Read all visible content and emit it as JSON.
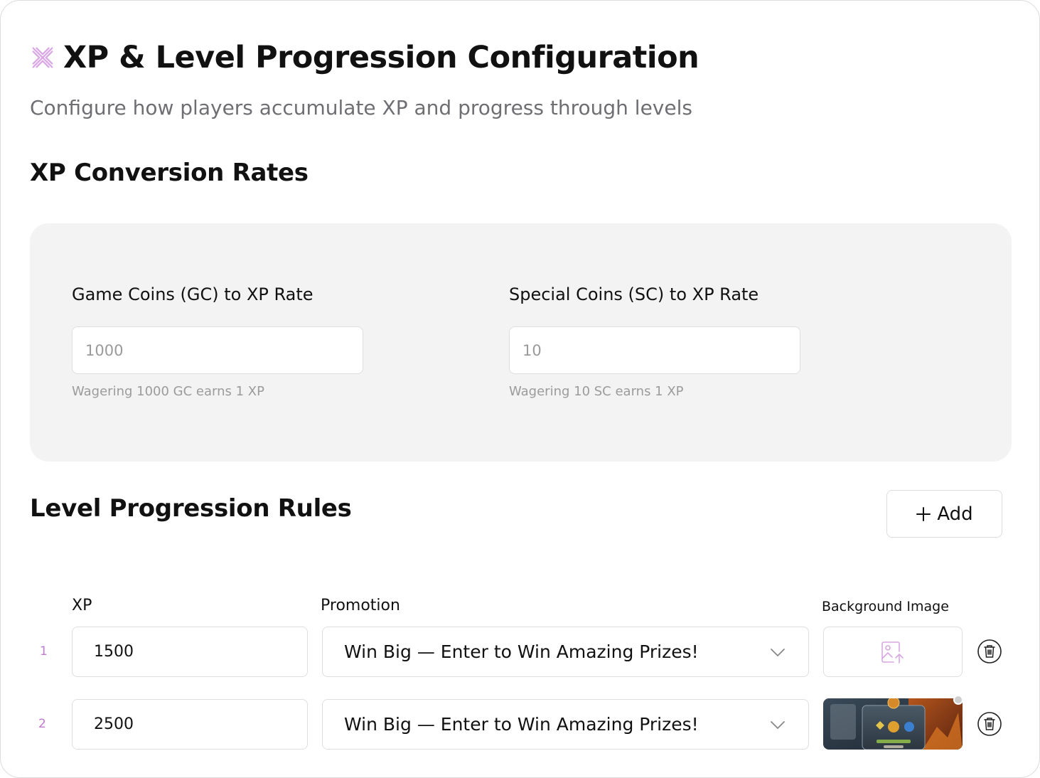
{
  "header": {
    "title": "XP & Level Progression Configuration",
    "subtitle": "Configure how players accumulate XP and progress through levels",
    "logo_icon": "sparkle-cross-icon"
  },
  "conversion": {
    "heading": "XP Conversion Rates",
    "gc": {
      "label": "Game Coins (GC) to XP Rate",
      "placeholder": "1000",
      "hint": "Wagering 1000 GC earns 1 XP"
    },
    "sc": {
      "label": "Special Coins (SC) to XP Rate",
      "placeholder": "10",
      "hint": "Wagering 10 SC earns 1 XP"
    }
  },
  "levels": {
    "heading": "Level Progression Rules",
    "add_label": "Add",
    "columns": {
      "xp": "XP",
      "promotion": "Promotion",
      "image": "Background Image"
    },
    "rows": [
      {
        "index": "1",
        "xp": "1500",
        "promotion": "Win Big — Enter to Win Amazing Prizes!",
        "image": "upload-image-icon"
      },
      {
        "index": "2",
        "xp": "2500",
        "promotion": "Win Big — Enter to Win Amazing Prizes!",
        "image": "level-up-game-thumbnail"
      }
    ]
  },
  "colors": {
    "accent": "#c07ad0",
    "panel_bg": "#f3f3f3",
    "border": "#dedede",
    "muted_text": "#6e6e73"
  }
}
